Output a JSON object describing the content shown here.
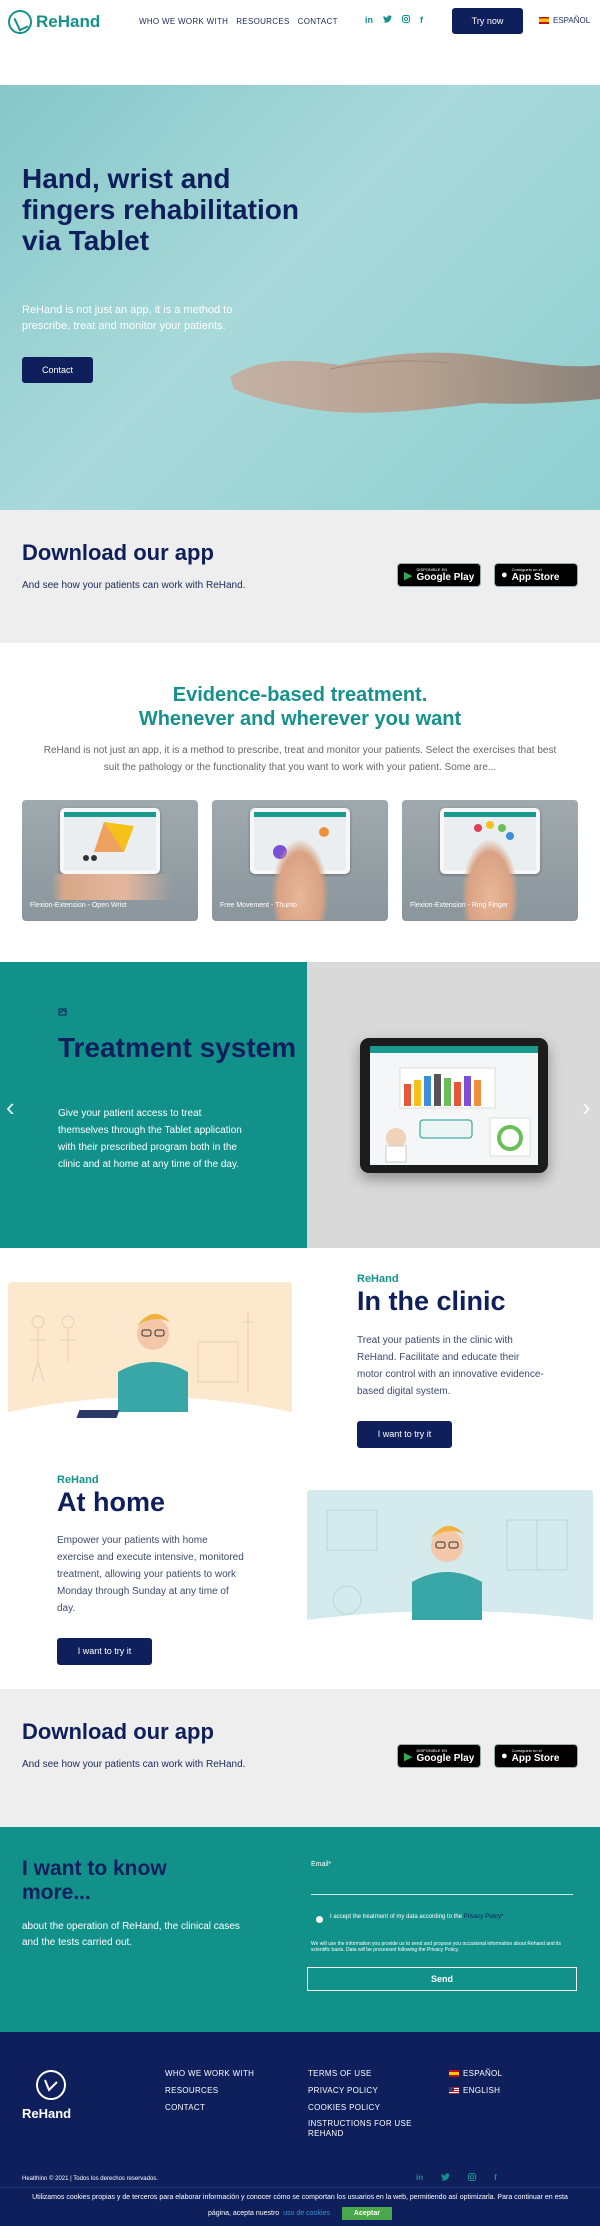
{
  "header": {
    "logo_text": "ReHand",
    "nav": [
      "WHO WE WORK WITH",
      "RESOURCES",
      "CONTACT"
    ],
    "social": [
      "in",
      "twitter",
      "instagram",
      "f"
    ],
    "cta": "Try now",
    "language": "ESPAÑOL"
  },
  "hero": {
    "title": "Hand, wrist and fingers rehabilitation via Tablet",
    "subtitle": "ReHand is not just an app, it is a method to prescribe, treat and monitor your patients.",
    "button": "Contact"
  },
  "download": {
    "title": "Download our app",
    "text": "And see how your patients can work with ReHand.",
    "google_small": "DISPONIBLE EN",
    "google_big": "Google Play",
    "apple_small": "Consíguelo en el",
    "apple_big": "App Store"
  },
  "evidence": {
    "title_line1": "Evidence-based treatment.",
    "title_line2": "Whenever and wherever you want",
    "text": "ReHand is not just an app, it is a method to prescribe, treat and monitor your patients. Select the exercises that best suit the pathology or the functionality that you want to work with your patient. Some are...",
    "cards": [
      "Flexion-Extension - Open Wrist",
      "Free Movement - Thumb",
      "Flexion-Extension - Ring Finger"
    ]
  },
  "treatment": {
    "title": "Treatment system",
    "text": "Give your patient access to treat themselves through the Tablet application with their prescribed program both in the clinic and at home at any time of the day."
  },
  "clinic": {
    "brand": "ReHand",
    "title": "In the clinic",
    "text": "Treat your patients in the clinic with ReHand. Facilitate and educate their motor control with an innovative evidence-based digital system.",
    "button": "I want to try it"
  },
  "home": {
    "brand": "ReHand",
    "title": "At home",
    "text": "Empower your patients with home exercise and execute intensive, monitored treatment, allowing your patients to work Monday through Sunday at any time of day.",
    "button": "I want to try it"
  },
  "contact": {
    "title": "I want to know more...",
    "text": "about the operation of ReHand, the clinical cases and the tests carried out.",
    "email_label": "Email*",
    "consent": "I accept the treatment of my data according to the",
    "consent_link": "Privacy Policy*",
    "disclaimer": "We will use the information you provide us to send and propose you occasional information about Rehand and its scientific basis. Data will be processed following the Privacy Policy.",
    "send": "Send"
  },
  "footer": {
    "logo_text": "ReHand",
    "col1": [
      "WHO WE WORK WITH",
      "RESOURCES",
      "CONTACT"
    ],
    "col2": [
      "TERMS OF USE",
      "PRIVACY POLICY",
      "COOKIES POLICY",
      "INSTRUCTIONS FOR USE REHAND"
    ],
    "lang_es": "ESPAÑOL",
    "lang_en": "ENGLISH",
    "copyright": "Healthinn © 2021 | Todos los derechos reservados."
  },
  "cookie": {
    "text": "Utilizamos cookies propias y de terceros para elaborar información y conocer cómo se comportan los usuarios en la web, permitiendo así optimizarla. Para continuar en esta",
    "text2": "página, acepta nuestro",
    "link": "uso de cookies",
    "accept": "Aceptar"
  },
  "colors": {
    "teal": "#12918b",
    "navy": "#0e1f5b",
    "grey": "#eeeeef"
  }
}
